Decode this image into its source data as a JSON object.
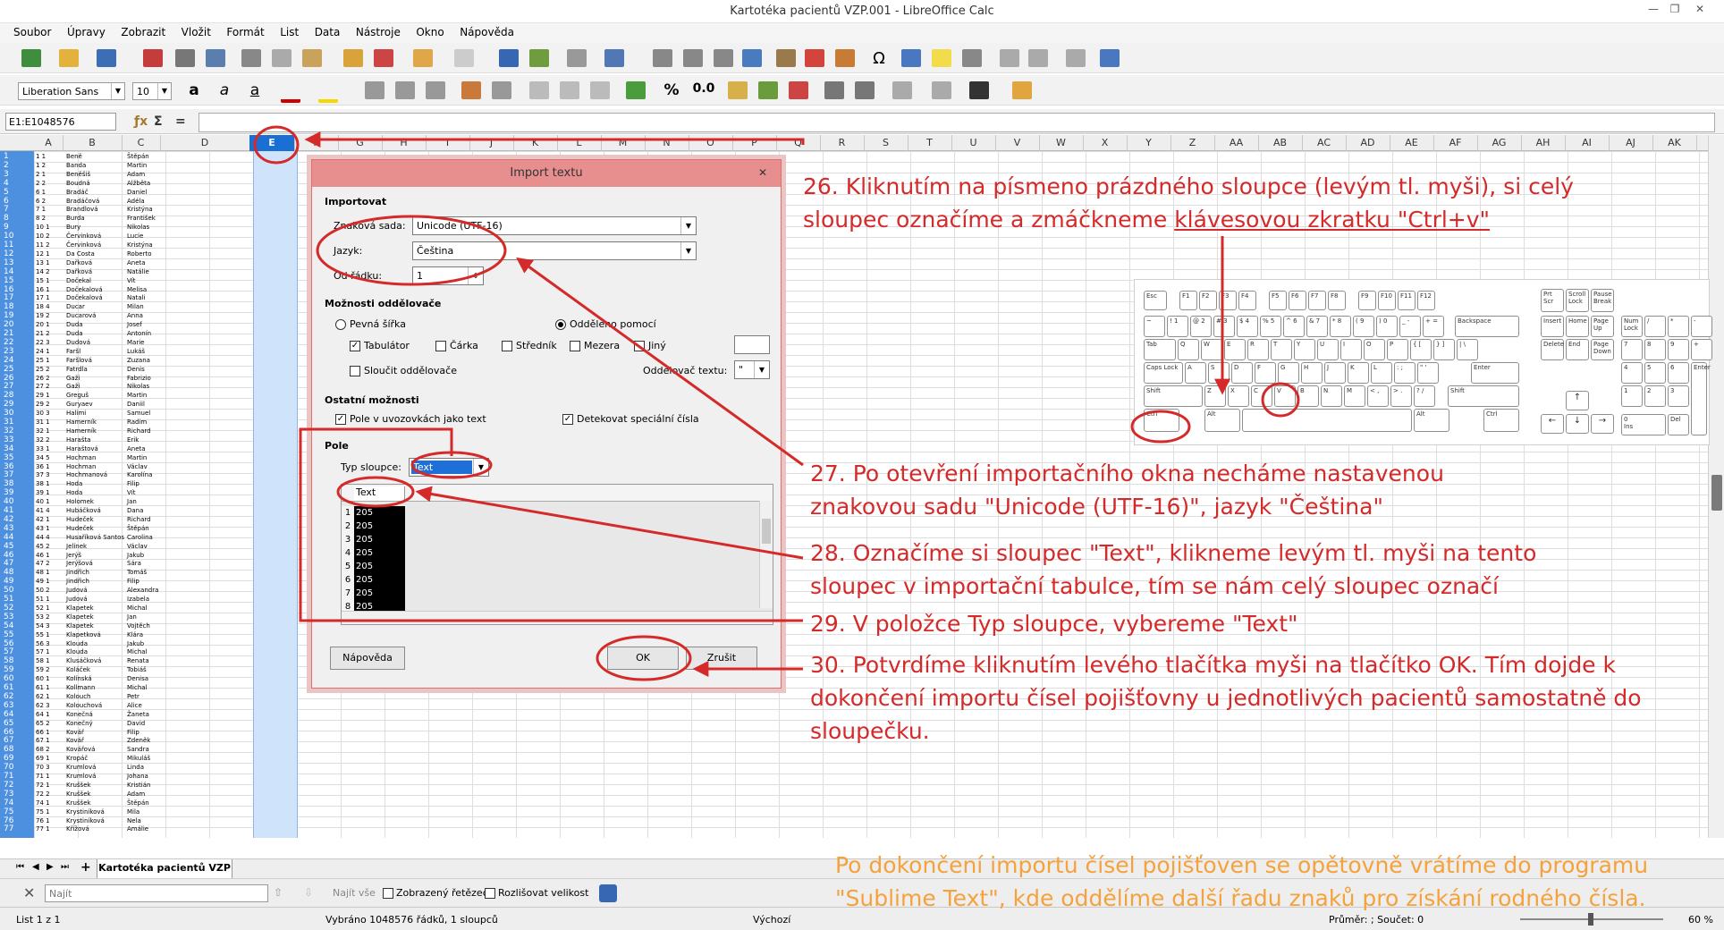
{
  "window": {
    "title": "Kartotéka pacientů VZP.001 - LibreOffice Calc",
    "controls": [
      "—",
      "❐",
      "✕"
    ]
  },
  "menu": [
    "Soubor",
    "Úpravy",
    "Zobrazit",
    "Vložit",
    "Formát",
    "List",
    "Data",
    "Nástroje",
    "Okno",
    "Nápověda"
  ],
  "format_toolbar": {
    "font_name": "Liberation Sans",
    "font_size": "10",
    "percent": "%",
    "decimal": "0.0"
  },
  "formula_bar": {
    "name_box": "E1:E1048576",
    "sum_symbol": "Σ",
    "equals_symbol": "="
  },
  "columns": [
    "A",
    "B",
    "C",
    "D",
    "E",
    "F",
    "G",
    "H",
    "I",
    "J",
    "K",
    "L",
    "M",
    "N",
    "O",
    "P",
    "Q",
    "R",
    "S",
    "T",
    "U",
    "V",
    "W",
    "X",
    "Y",
    "Z",
    "AA",
    "AB",
    "AC",
    "AD",
    "AE",
    "AF",
    "AG",
    "AH",
    "AI",
    "AJ",
    "AK"
  ],
  "selected_column": "E",
  "sheet_rows": [
    {
      "n": "1",
      "a": "1 1",
      "b": "Beně",
      "c": "Štěpán"
    },
    {
      "n": "2",
      "a": "1 2",
      "b": "Banda",
      "c": "Martin"
    },
    {
      "n": "3",
      "a": "2 1",
      "b": "Beněšiš",
      "c": "Adam"
    },
    {
      "n": "4",
      "a": "2 2",
      "b": "Boudná",
      "c": "Alžběta"
    },
    {
      "n": "5",
      "a": "6 1",
      "b": "Bradáč",
      "c": "Daniel"
    },
    {
      "n": "6",
      "a": "6 2",
      "b": "Bradáčová",
      "c": "Adéla"
    },
    {
      "n": "7",
      "a": "7 1",
      "b": "Brandlová",
      "c": "Kristýna"
    },
    {
      "n": "8",
      "a": "8 2",
      "b": "Burda",
      "c": "František"
    },
    {
      "n": "9",
      "a": "10 1",
      "b": "Bury",
      "c": "Nikolas"
    },
    {
      "n": "10",
      "a": "10 2",
      "b": "Červinková",
      "c": "Lucie"
    },
    {
      "n": "11",
      "a": "11 2",
      "b": "Červinková",
      "c": "Kristýna"
    },
    {
      "n": "12",
      "a": "12 1",
      "b": "Da Costa",
      "c": "Roberto"
    },
    {
      "n": "13",
      "a": "13 1",
      "b": "Dařková",
      "c": "Aneta"
    },
    {
      "n": "14",
      "a": "14 2",
      "b": "Dařková",
      "c": "Natálie"
    },
    {
      "n": "15",
      "a": "15 1",
      "b": "Dočekal",
      "c": "Vít"
    },
    {
      "n": "16",
      "a": "16 1",
      "b": "Dočekalová",
      "c": "Melisa"
    },
    {
      "n": "17",
      "a": "17 1",
      "b": "Dočekalová",
      "c": "Natali"
    },
    {
      "n": "18",
      "a": "18 4",
      "b": "Ducar",
      "c": "Milan"
    },
    {
      "n": "19",
      "a": "19 2",
      "b": "Ducarová",
      "c": "Anna"
    },
    {
      "n": "20",
      "a": "20 1",
      "b": "Duda",
      "c": "Josef"
    },
    {
      "n": "21",
      "a": "21 2",
      "b": "Duda",
      "c": "Antonín"
    },
    {
      "n": "22",
      "a": "22 3",
      "b": "Dudová",
      "c": "Marie"
    },
    {
      "n": "23",
      "a": "24 1",
      "b": "Faršl",
      "c": "Lukáš"
    },
    {
      "n": "24",
      "a": "25 1",
      "b": "Faršlová",
      "c": "Zuzana"
    },
    {
      "n": "25",
      "a": "25 2",
      "b": "Fatrdla",
      "c": "Denis"
    },
    {
      "n": "26",
      "a": "26 2",
      "b": "Gaži",
      "c": "Fabrizio"
    },
    {
      "n": "27",
      "a": "27 2",
      "b": "Gaži",
      "c": "Nikolas"
    },
    {
      "n": "28",
      "a": "29 1",
      "b": "Greguš",
      "c": "Martin"
    },
    {
      "n": "29",
      "a": "29 2",
      "b": "Guryaev",
      "c": "Daniil"
    },
    {
      "n": "30",
      "a": "30 3",
      "b": "Halimi",
      "c": "Samuel"
    },
    {
      "n": "31",
      "a": "31 1",
      "b": "Hamerník",
      "c": "Radim"
    },
    {
      "n": "32",
      "a": "32 1",
      "b": "Hamerník",
      "c": "Richard"
    },
    {
      "n": "33",
      "a": "32 2",
      "b": "Harašta",
      "c": "Erik"
    },
    {
      "n": "34",
      "a": "33 1",
      "b": "Haraštová",
      "c": "Aneta"
    },
    {
      "n": "35",
      "a": "34 5",
      "b": "Hochman",
      "c": "Martin"
    },
    {
      "n": "36",
      "a": "36 1",
      "b": "Hochman",
      "c": "Václav"
    },
    {
      "n": "37",
      "a": "37 3",
      "b": "Hochmanová",
      "c": "Karolína"
    },
    {
      "n": "38",
      "a": "38 1",
      "b": "Hoda",
      "c": "Filip"
    },
    {
      "n": "39",
      "a": "39 1",
      "b": "Hoda",
      "c": "Vít"
    },
    {
      "n": "40",
      "a": "40 1",
      "b": "Holomek",
      "c": "Jan"
    },
    {
      "n": "41",
      "a": "41 4",
      "b": "Hubáčková",
      "c": "Dana"
    },
    {
      "n": "42",
      "a": "42 1",
      "b": "Hudeček",
      "c": "Richard"
    },
    {
      "n": "43",
      "a": "43 1",
      "b": "Hudeček",
      "c": "Štěpán"
    },
    {
      "n": "44",
      "a": "44 4",
      "b": "Husaříková Santos",
      "c": "Carolina"
    },
    {
      "n": "45",
      "a": "45 2",
      "b": "Jelínek",
      "c": "Václav"
    },
    {
      "n": "46",
      "a": "46 1",
      "b": "Jerýš",
      "c": "Jakub"
    },
    {
      "n": "47",
      "a": "47 2",
      "b": "Jerýšová",
      "c": "Sára"
    },
    {
      "n": "48",
      "a": "48 1",
      "b": "Jindřich",
      "c": "Tomáš"
    },
    {
      "n": "49",
      "a": "49 1",
      "b": "Jindřich",
      "c": "Filip"
    },
    {
      "n": "50",
      "a": "50 2",
      "b": "Judová",
      "c": "Alexandra"
    },
    {
      "n": "51",
      "a": "51 1",
      "b": "Judová",
      "c": "Izabela"
    },
    {
      "n": "52",
      "a": "52 1",
      "b": "Klapetek",
      "c": "Michal"
    },
    {
      "n": "53",
      "a": "53 2",
      "b": "Klapetek",
      "c": "Jan"
    },
    {
      "n": "54",
      "a": "54 3",
      "b": "Klapetek",
      "c": "Vojtěch"
    },
    {
      "n": "55",
      "a": "55 1",
      "b": "Klapetková",
      "c": "Klára"
    },
    {
      "n": "56",
      "a": "56 3",
      "b": "Klouda",
      "c": "Jakub"
    },
    {
      "n": "57",
      "a": "57 1",
      "b": "Klouda",
      "c": "Michal"
    },
    {
      "n": "58",
      "a": "58 1",
      "b": "Klusáčková",
      "c": "Renata"
    },
    {
      "n": "59",
      "a": "59 2",
      "b": "Koláček",
      "c": "Tobiáš"
    },
    {
      "n": "60",
      "a": "60 1",
      "b": "Kolínská",
      "c": "Denisa"
    },
    {
      "n": "61",
      "a": "61 1",
      "b": "Kollmann",
      "c": "Michal"
    },
    {
      "n": "62",
      "a": "62 1",
      "b": "Kolouch",
      "c": "Petr"
    },
    {
      "n": "63",
      "a": "62 3",
      "b": "Kolouchová",
      "c": "Alice"
    },
    {
      "n": "64",
      "a": "64 1",
      "b": "Konečná",
      "c": "Žaneta"
    },
    {
      "n": "65",
      "a": "65 2",
      "b": "Konečný",
      "c": "David"
    },
    {
      "n": "66",
      "a": "66 1",
      "b": "Kovář",
      "c": "Filip"
    },
    {
      "n": "67",
      "a": "67 1",
      "b": "Kovář",
      "c": "Zdeněk"
    },
    {
      "n": "68",
      "a": "68 2",
      "b": "Kovářová",
      "c": "Sandra"
    },
    {
      "n": "69",
      "a": "69 1",
      "b": "Kropáč",
      "c": "Mikuláš"
    },
    {
      "n": "70",
      "a": "70 3",
      "b": "Krumlová",
      "c": "Linda"
    },
    {
      "n": "71",
      "a": "71 1",
      "b": "Krumlová",
      "c": "Johana"
    },
    {
      "n": "72",
      "a": "72 1",
      "b": "Kruššek",
      "c": "Kristián"
    },
    {
      "n": "73",
      "a": "72 2",
      "b": "Kruššek",
      "c": "Adam"
    },
    {
      "n": "74",
      "a": "74 1",
      "b": "Kruššek",
      "c": "Štěpán"
    },
    {
      "n": "75",
      "a": "75 1",
      "b": "Krystiníková",
      "c": "Mila"
    },
    {
      "n": "76",
      "a": "76 1",
      "b": "Krystiníková",
      "c": "Nela"
    },
    {
      "n": "77",
      "a": "77 1",
      "b": "Křížová",
      "c": "Amálie"
    }
  ],
  "sheet_tab": "Kartotéka pacientů VZP",
  "tab_add": "+",
  "find_bar": {
    "placeholder": "Najít",
    "find_all": "Najít vše",
    "shown_string": "Zobrazený řetězec",
    "match_case": "Rozlišovat velikost"
  },
  "status_bar": {
    "sheet": "List 1 z 1",
    "selection": "Vybráno 1048576 řádků, 1 sloupců",
    "style": "Výchozí",
    "sum": "Průměr: ; Součet: 0",
    "zoom": "60 %"
  },
  "dialog": {
    "title": "Import textu",
    "close": "✕",
    "import_section": "Importovat",
    "charset_label": "Znaková sada:",
    "charset_value": "Unicode (UTF-16)",
    "language_label": "Jazyk:",
    "language_value": "Čeština",
    "from_row_label": "Od řádku:",
    "from_row_value": "1",
    "separator_section": "Možnosti oddělovače",
    "fixed_width": "Pevná šířka",
    "separated_by": "Odděleno pomocí",
    "tab": "Tabulátor",
    "comma": "Čárka",
    "semicolon": "Středník",
    "space": "Mezera",
    "other": "Jiný",
    "merge_delimiters": "Sloučit oddělovače",
    "text_delimiter_label": "Oddělovač textu:",
    "text_delimiter_value": "\"",
    "other_options_section": "Ostatní možnosti",
    "quoted_as_text": "Pole v uvozovkách jako text",
    "detect_special": "Detekovat speciální čísla",
    "fields_section": "Pole",
    "column_type_label": "Typ sloupce:",
    "column_type_value": "Text",
    "preview_header": "Text",
    "preview_values": [
      "205",
      "205",
      "205",
      "205",
      "205",
      "205",
      "205",
      "205"
    ],
    "help_button": "Nápověda",
    "ok_button": "OK",
    "cancel_button": "Zrušit"
  },
  "annotations": {
    "step26_line1": "26. Kliknutím na písmeno prázdného sloupce (levým tl. myši), si celý",
    "step26_line2a": "sloupec označíme a zmáčkneme ",
    "step26_line2b": "klávesovou zkratku \"Ctrl+v\"",
    "step27_line1": "27. Po otevření importačního okna necháme nastavenou",
    "step27_line2": "znakovou sadu \"Unicode (UTF-16)\", jazyk \"Čeština\"",
    "step28_line1": "28. Označíme si sloupec \"Text\",  klikneme levým tl. myši na tento",
    "step28_line2": "sloupec v importační tabulce, tím se nám celý sloupec označí",
    "step29": "29. V položce Typ sloupce, vybereme \"Text\"",
    "step30_line1": "30. Potvrdíme kliknutím levého tlačítka myši na tlačítko OK. Tím dojde k",
    "step30_line2": "dokončení importu čísel pojišťovny u jednotlivých pacientů samostatně do",
    "step30_line3": "sloupečku.",
    "footer_line1": "Po dokončení importu čísel pojišťoven se opětovně vrátíme do programu",
    "footer_line2": "\"Sublime Text\", kde oddělíme další řadu znaků pro získání rodného čísla."
  },
  "keyboard": {
    "esc": "Esc",
    "fkeys": [
      "F1",
      "F2",
      "F3",
      "F4",
      "F5",
      "F6",
      "F7",
      "F8",
      "F9",
      "F10",
      "F11",
      "F12"
    ],
    "prtsc": "Prt Scr",
    "scroll_lock": "Scroll Lock",
    "pause": "Pause Break",
    "number_row": [
      "~",
      "! 1",
      "@ 2",
      "# 3",
      "$ 4",
      "% 5",
      "^ 6",
      "& 7",
      "* 8",
      "( 9",
      ") 0",
      "_ -",
      "+ ="
    ],
    "backspace": "Backspace",
    "insert": "Insert",
    "home": "Home",
    "page_up": "Page Up",
    "num_lock": "Num Lock",
    "tab_key": "Tab",
    "qrow": [
      "Q",
      "W",
      "E",
      "R",
      "T",
      "Y",
      "U",
      "I",
      "O",
      "P",
      "{ [",
      "} ]",
      "| \\"
    ],
    "delete": "Delete",
    "end": "End",
    "page_down": "Page Down",
    "caps": "Caps Lock",
    "arow": [
      "A",
      "S",
      "D",
      "F",
      "G",
      "H",
      "J",
      "K",
      "L",
      ": ;",
      "\" '"
    ],
    "enter": "Enter",
    "shift": "Shift",
    "zrow": [
      "Z",
      "X",
      "C",
      "V",
      "B",
      "N",
      "M",
      "< ,",
      "> .",
      "? /"
    ],
    "ctrl": "Ctrl",
    "alt": "Alt",
    "alt_gr": "Alt",
    "ctrl_r": "Ctrl",
    "arrows": [
      "↑",
      "←",
      "↓",
      "→"
    ],
    "numpad": [
      "/",
      "*",
      "-",
      "7",
      "8",
      "9",
      "+",
      "4",
      "5",
      "6",
      "1",
      "2",
      "3",
      "Enter",
      "0",
      "Del"
    ],
    "ins_label": "Ins"
  },
  "colors": {
    "annotation_red": "#d42a2a",
    "annotation_orange": "#f5a23c",
    "selection_blue": "#1a6fd4"
  }
}
